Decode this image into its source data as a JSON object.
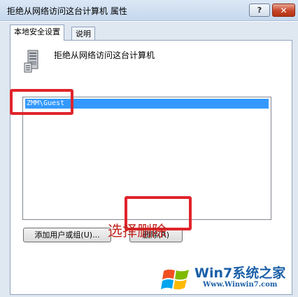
{
  "window": {
    "title": "拒绝从网络访问这台计算机 属性",
    "help_label": "?",
    "close_label": "✕"
  },
  "tabs": [
    {
      "label": "本地安全设置",
      "active": true
    },
    {
      "label": "说明",
      "active": false
    }
  ],
  "policy": {
    "icon": "server-computer-icon",
    "name": "拒绝从网络访问这台计算机"
  },
  "accounts_list": {
    "items": [
      {
        "label": "ZMM\\Guest",
        "selected": true
      }
    ]
  },
  "buttons": {
    "add_label": "添加用户或组(U)...",
    "remove_label": "删除(R)"
  },
  "annotation": {
    "text": "选择删除",
    "color": "#c0251f"
  },
  "watermark": {
    "brand": "Win7系统之家",
    "url": "Www.Winwin7.com",
    "icon": "windows-flag-logo"
  },
  "colors": {
    "selection": "#3399ff",
    "highlight_box": "#e0242b",
    "close_button": "#c7462a"
  }
}
